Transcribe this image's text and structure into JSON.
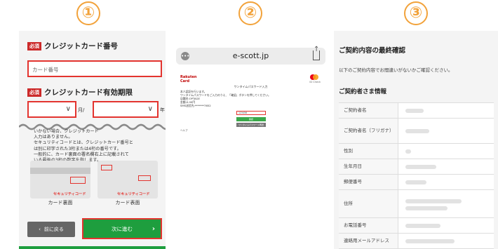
{
  "step_numbers": [
    "①",
    "②",
    "③"
  ],
  "panel1": {
    "required_badge": "必須",
    "card_number_title": "クレジットカード番号",
    "card_number_placeholder": "カード番号",
    "expiry_title": "クレジットカード有効期限",
    "month_suffix": "月/",
    "year_suffix": "年",
    "note_line1": "いかない場合、クレジットカード",
    "note_line2": "入力はありません。",
    "note_line3": "セキュリティコードとは、クレジットカード番号と",
    "note_line4": "は別に印字された3桁または4桁の番号です。",
    "note_line5": "一般的に、カード裏面の署名欄右上に記載されて",
    "note_line6": "いる最後の3桁の数字を指します。",
    "security_code_label": "セキュリティコード",
    "card_back_caption": "カード裏面",
    "card_front_caption": "カード表面",
    "back_button": "前に戻る",
    "next_button": "次に進む"
  },
  "panel2": {
    "url": "e-scott.jp",
    "brand": "Rakuten Card",
    "mc_label": "ID Check",
    "page_title": "ワンタイムパスワード入力",
    "body_line1": "本人認証を行います。",
    "body_line2": "ワンタイムパスワードをご入力のうえ、「確認」ボタンを押してください。",
    "body_line3": "店舗名:OPTAGE",
    "body_line4": "金額:0.00円",
    "body_line5": "SMS送信先:*******7652",
    "otp_value": "123456",
    "confirm_button": "確認",
    "resend_button": "ワンタイムパスワード再送",
    "help_link": "ヘルプ"
  },
  "panel3": {
    "title": "ご契約内容の最終確認",
    "description": "以下のご契約内容でお間違いがないかご確認ください。",
    "section_title": "ご契約者さま情報",
    "rows": [
      {
        "label": "ご契約者名"
      },
      {
        "label": "ご契約者名（フリガナ）"
      },
      {
        "label": "性別"
      },
      {
        "label": "生年月日"
      },
      {
        "label": "郵便番号"
      },
      {
        "label": "住所"
      },
      {
        "label": "お電話番号"
      },
      {
        "label": "連絡用メールアドレス"
      }
    ]
  },
  "colors": {
    "step_accent": "#f2a23a",
    "highlight": "#e3342f",
    "primary_green": "#1e9e3e",
    "required_red": "#cc2a2a"
  }
}
